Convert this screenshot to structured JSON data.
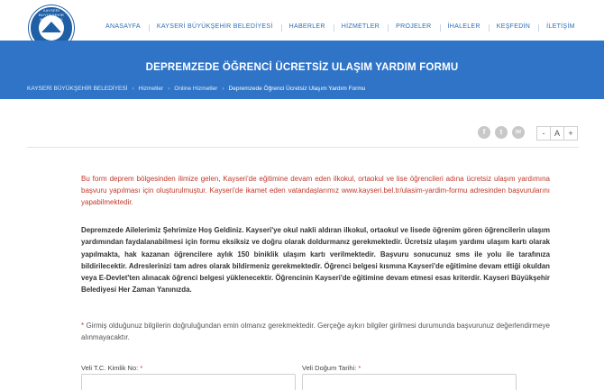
{
  "header": {
    "logo": {
      "ring_text": "KAYSERİ BÜYÜKŞEHİR BELEDİYESİ",
      "year": "1869",
      "icon": "municipality-emblem"
    },
    "nav": [
      {
        "label": "ANASAYFA"
      },
      {
        "label": "KAYSERİ BÜYÜKŞEHİR BELEDİYESİ"
      },
      {
        "label": "HABERLER"
      },
      {
        "label": "HİZMETLER"
      },
      {
        "label": "PROJELER"
      },
      {
        "label": "İHALELER"
      },
      {
        "label": "KEŞFEDİN"
      },
      {
        "label": "İLETİŞİM"
      }
    ]
  },
  "banner": {
    "title": "DEPREMZEDE ÖĞRENCİ ÜCRETSİZ ULAŞIM YARDIM FORMU",
    "breadcrumb": [
      "KAYSERİ BÜYÜKŞEHİR BELEDİYESİ",
      "Hizmetler",
      "Online Hizmetler",
      "Depremzede Öğrenci Ücretsiz Ulaşım Yardım Formu"
    ],
    "separator": "›"
  },
  "toolbar": {
    "share": [
      {
        "icon": "facebook-icon",
        "glyph": "f"
      },
      {
        "icon": "twitter-icon",
        "glyph": "t"
      },
      {
        "icon": "email-icon",
        "glyph": "✉"
      }
    ],
    "font_controls": {
      "decrease": "-",
      "reset": "A",
      "increase": "+"
    }
  },
  "content": {
    "intro_red": "Bu form deprem bölgesinden ilimize gelen, Kayseri'de eğitimine devam eden ilkokul, ortaokul ve lise öğrencileri adına ücretsiz ulaşım yardımına başvuru yapılması için oluşturulmuştur. Kayseri'de ikamet eden vatandaşlarımız www.kayseri.bel.tr/ulasim-yardim-formu adresinden başvurularını yapabilmektedir.",
    "welcome": "Depremzede Ailelerimiz Şehrimize Hoş Geldiniz. Kayseri'ye okul nakli aldıran ilkokul, ortaokul ve lisede öğrenim gören öğrencilerin ulaşım yardımından faydalanabilmesi için formu eksiksiz ve doğru olarak doldurmanız gerekmektedir. Ücretsiz ulaşım yardımı ulaşım kartı olarak yapılmakta, hak kazanan öğrencilere aylık 150 biniklik ulaşım kartı verilmektedir. Başvuru sonucunuz sms ile yolu ile tarafınıza bildirilecektir. Adreslerinizi tam adres olarak bildirmeniz gerekmektedir. Öğrenci belgesi kısmına Kayseri'de eğitimine devam ettiği okuldan veya E-Devlet'ten alınacak öğrenci belgesi yüklenecektir. Öğrencinin Kayseri'de eğitimine devam etmesi esas kriterdir. Kayseri Büyükşehir Belediyesi Her Zaman Yanınızda.",
    "notice_star": "*",
    "notice": "Girmiş olduğunuz bilgilerin doğruluğundan emin olmanız gerekmektedir. Gerçeğe aykırı bilgiler girilmesi durumunda başvurunuz değerlendirmeye alınmayacaktır."
  },
  "form": {
    "guardian_tc": {
      "label": "Veli T.C. Kimlik No:",
      "required": "*",
      "value": ""
    },
    "guardian_birthdate": {
      "label": "Veli Doğum Tarihi:",
      "required": "*",
      "value": ""
    }
  },
  "colors": {
    "banner": "#2f74c7",
    "nav_text": "#2c6fb7",
    "alert_red": "#c0392b"
  }
}
